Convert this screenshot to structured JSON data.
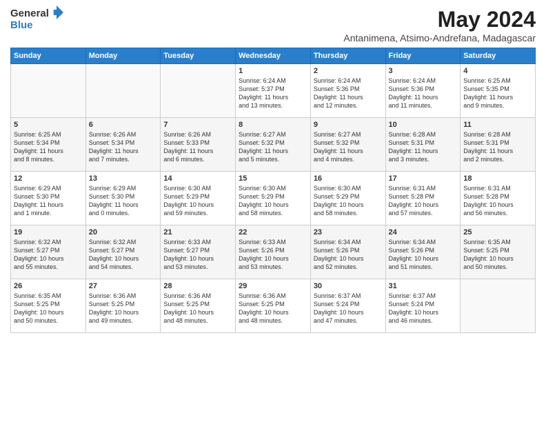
{
  "header": {
    "logo_general": "General",
    "logo_blue": "Blue",
    "month_year": "May 2024",
    "location": "Antanimena, Atsimo-Andrefana, Madagascar"
  },
  "weekdays": [
    "Sunday",
    "Monday",
    "Tuesday",
    "Wednesday",
    "Thursday",
    "Friday",
    "Saturday"
  ],
  "weeks": [
    [
      {
        "day": "",
        "info": ""
      },
      {
        "day": "",
        "info": ""
      },
      {
        "day": "",
        "info": ""
      },
      {
        "day": "1",
        "info": "Sunrise: 6:24 AM\nSunset: 5:37 PM\nDaylight: 11 hours\nand 13 minutes."
      },
      {
        "day": "2",
        "info": "Sunrise: 6:24 AM\nSunset: 5:36 PM\nDaylight: 11 hours\nand 12 minutes."
      },
      {
        "day": "3",
        "info": "Sunrise: 6:24 AM\nSunset: 5:36 PM\nDaylight: 11 hours\nand 11 minutes."
      },
      {
        "day": "4",
        "info": "Sunrise: 6:25 AM\nSunset: 5:35 PM\nDaylight: 11 hours\nand 9 minutes."
      }
    ],
    [
      {
        "day": "5",
        "info": "Sunrise: 6:25 AM\nSunset: 5:34 PM\nDaylight: 11 hours\nand 8 minutes."
      },
      {
        "day": "6",
        "info": "Sunrise: 6:26 AM\nSunset: 5:34 PM\nDaylight: 11 hours\nand 7 minutes."
      },
      {
        "day": "7",
        "info": "Sunrise: 6:26 AM\nSunset: 5:33 PM\nDaylight: 11 hours\nand 6 minutes."
      },
      {
        "day": "8",
        "info": "Sunrise: 6:27 AM\nSunset: 5:32 PM\nDaylight: 11 hours\nand 5 minutes."
      },
      {
        "day": "9",
        "info": "Sunrise: 6:27 AM\nSunset: 5:32 PM\nDaylight: 11 hours\nand 4 minutes."
      },
      {
        "day": "10",
        "info": "Sunrise: 6:28 AM\nSunset: 5:31 PM\nDaylight: 11 hours\nand 3 minutes."
      },
      {
        "day": "11",
        "info": "Sunrise: 6:28 AM\nSunset: 5:31 PM\nDaylight: 11 hours\nand 2 minutes."
      }
    ],
    [
      {
        "day": "12",
        "info": "Sunrise: 6:29 AM\nSunset: 5:30 PM\nDaylight: 11 hours\nand 1 minute."
      },
      {
        "day": "13",
        "info": "Sunrise: 6:29 AM\nSunset: 5:30 PM\nDaylight: 11 hours\nand 0 minutes."
      },
      {
        "day": "14",
        "info": "Sunrise: 6:30 AM\nSunset: 5:29 PM\nDaylight: 10 hours\nand 59 minutes."
      },
      {
        "day": "15",
        "info": "Sunrise: 6:30 AM\nSunset: 5:29 PM\nDaylight: 10 hours\nand 58 minutes."
      },
      {
        "day": "16",
        "info": "Sunrise: 6:30 AM\nSunset: 5:29 PM\nDaylight: 10 hours\nand 58 minutes."
      },
      {
        "day": "17",
        "info": "Sunrise: 6:31 AM\nSunset: 5:28 PM\nDaylight: 10 hours\nand 57 minutes."
      },
      {
        "day": "18",
        "info": "Sunrise: 6:31 AM\nSunset: 5:28 PM\nDaylight: 10 hours\nand 56 minutes."
      }
    ],
    [
      {
        "day": "19",
        "info": "Sunrise: 6:32 AM\nSunset: 5:27 PM\nDaylight: 10 hours\nand 55 minutes."
      },
      {
        "day": "20",
        "info": "Sunrise: 6:32 AM\nSunset: 5:27 PM\nDaylight: 10 hours\nand 54 minutes."
      },
      {
        "day": "21",
        "info": "Sunrise: 6:33 AM\nSunset: 5:27 PM\nDaylight: 10 hours\nand 53 minutes."
      },
      {
        "day": "22",
        "info": "Sunrise: 6:33 AM\nSunset: 5:26 PM\nDaylight: 10 hours\nand 53 minutes."
      },
      {
        "day": "23",
        "info": "Sunrise: 6:34 AM\nSunset: 5:26 PM\nDaylight: 10 hours\nand 52 minutes."
      },
      {
        "day": "24",
        "info": "Sunrise: 6:34 AM\nSunset: 5:26 PM\nDaylight: 10 hours\nand 51 minutes."
      },
      {
        "day": "25",
        "info": "Sunrise: 6:35 AM\nSunset: 5:25 PM\nDaylight: 10 hours\nand 50 minutes."
      }
    ],
    [
      {
        "day": "26",
        "info": "Sunrise: 6:35 AM\nSunset: 5:25 PM\nDaylight: 10 hours\nand 50 minutes."
      },
      {
        "day": "27",
        "info": "Sunrise: 6:36 AM\nSunset: 5:25 PM\nDaylight: 10 hours\nand 49 minutes."
      },
      {
        "day": "28",
        "info": "Sunrise: 6:36 AM\nSunset: 5:25 PM\nDaylight: 10 hours\nand 48 minutes."
      },
      {
        "day": "29",
        "info": "Sunrise: 6:36 AM\nSunset: 5:25 PM\nDaylight: 10 hours\nand 48 minutes."
      },
      {
        "day": "30",
        "info": "Sunrise: 6:37 AM\nSunset: 5:24 PM\nDaylight: 10 hours\nand 47 minutes."
      },
      {
        "day": "31",
        "info": "Sunrise: 6:37 AM\nSunset: 5:24 PM\nDaylight: 10 hours\nand 46 minutes."
      },
      {
        "day": "",
        "info": ""
      }
    ]
  ]
}
